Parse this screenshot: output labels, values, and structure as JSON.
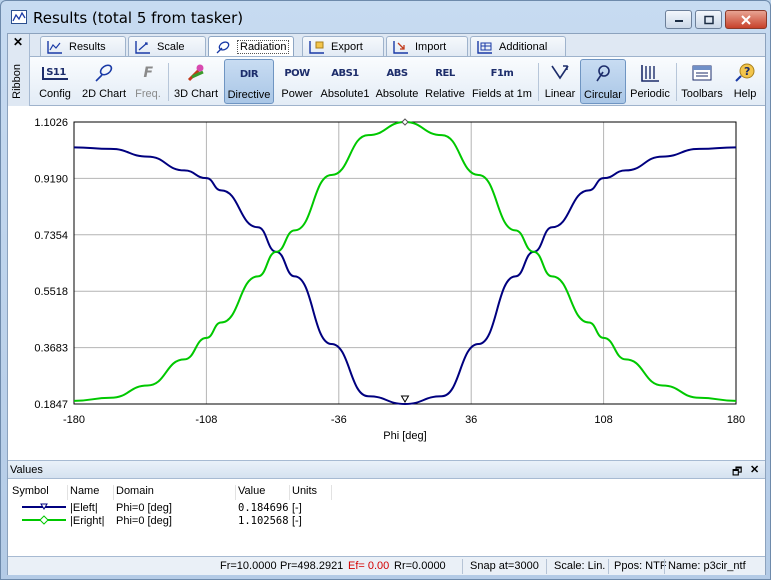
{
  "window": {
    "title": "Results (total 5 from tasker)"
  },
  "ribbon": {
    "side_label": "Ribbon",
    "close_glyph": "✕",
    "tabs": [
      {
        "label": "Results",
        "icon": "results-icon"
      },
      {
        "label": "Scale",
        "icon": "scale-icon"
      },
      {
        "label": "Radiation",
        "icon": "radiation-icon",
        "active": true
      },
      {
        "label": "Export",
        "icon": "export-icon"
      },
      {
        "label": "Import",
        "icon": "import-icon"
      },
      {
        "label": "Additional",
        "icon": "additional-icon"
      }
    ],
    "buttons": [
      {
        "label": "Config",
        "icon_text": "S11"
      },
      {
        "label": "2D Chart"
      },
      {
        "label": "Freq.",
        "icon_text": "F",
        "disabled": true
      },
      {
        "label": "3D Chart"
      },
      {
        "label": "Directive",
        "icon_text": "DIR",
        "pressed": true
      },
      {
        "label": "Power",
        "icon_text": "POW"
      },
      {
        "label": "Absolute1",
        "icon_text": "ABS1"
      },
      {
        "label": "Absolute",
        "icon_text": "ABS"
      },
      {
        "label": "Relative",
        "icon_text": "REL"
      },
      {
        "label": "Fields at 1m",
        "icon_text": "F1m"
      },
      {
        "label": "Linear"
      },
      {
        "label": "Circular",
        "pressed": true
      },
      {
        "label": "Periodic"
      },
      {
        "label": "Toolbars"
      },
      {
        "label": "Help"
      }
    ]
  },
  "chart_data": {
    "type": "line",
    "xlabel": "Phi [deg]",
    "ylabel": "",
    "xlim": [
      -180,
      180
    ],
    "ylim": [
      0.1847,
      1.1026
    ],
    "xticks": [
      -180,
      -108,
      -36,
      36,
      108,
      180
    ],
    "xtick_labels": [
      "-180",
      "-108",
      "-36",
      "36",
      "108",
      "180"
    ],
    "yticks": [
      0.1847,
      0.3683,
      0.5518,
      0.7354,
      0.919,
      1.1026
    ],
    "ytick_labels": [
      "0.1847",
      "0.3683",
      "0.5518",
      "0.7354",
      "0.9190",
      "1.1026"
    ],
    "grid": true,
    "x": [
      -180,
      -160,
      -140,
      -120,
      -108,
      -100,
      -80,
      -70,
      -60,
      -40,
      -20,
      0,
      20,
      40,
      60,
      70,
      80,
      100,
      108,
      120,
      140,
      160,
      180
    ],
    "series": [
      {
        "name": "|Eleft|",
        "color": "#00007f",
        "marker": "triangle-down",
        "values": [
          1.02,
          1.015,
          0.99,
          0.945,
          0.92,
          0.88,
          0.76,
          0.68,
          0.6,
          0.38,
          0.21,
          0.1847,
          0.21,
          0.38,
          0.6,
          0.68,
          0.76,
          0.88,
          0.92,
          0.945,
          0.99,
          1.015,
          1.02
        ]
      },
      {
        "name": "|Eright|",
        "color": "#00c800",
        "marker": "diamond",
        "values": [
          0.195,
          0.205,
          0.245,
          0.33,
          0.4,
          0.45,
          0.6,
          0.68,
          0.75,
          0.93,
          1.06,
          1.1026,
          1.06,
          0.93,
          0.75,
          0.68,
          0.6,
          0.45,
          0.4,
          0.33,
          0.245,
          0.205,
          0.195
        ]
      }
    ]
  },
  "values_panel": {
    "title": "Values",
    "headers": [
      "Symbol",
      "Name",
      "Domain",
      "Value",
      "Units"
    ],
    "rows": [
      {
        "name": "|Eleft|",
        "domain": "Phi=0 [deg]",
        "value": "0.184696",
        "units": "[-]",
        "color": "#00007f",
        "marker": "triangle-down-icon"
      },
      {
        "name": "|Eright|",
        "domain": "Phi=0 [deg]",
        "value": "1.102568",
        "units": "[-]",
        "color": "#00c800",
        "marker": "diamond-icon"
      }
    ]
  },
  "status": {
    "fr": "Fr=10.0000",
    "pr": "Pr=498.2921",
    "ef": "Ef= 0.00",
    "rr": "Rr=0.0000",
    "snap": "Snap at=3000",
    "scale": "Scale: Lin.",
    "ppos": "Ppos: NTF",
    "name": "Name: p3cir_ntf"
  }
}
